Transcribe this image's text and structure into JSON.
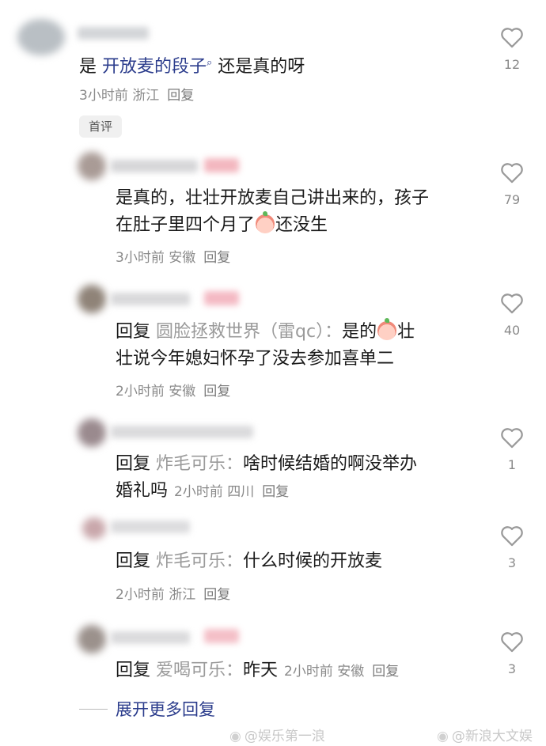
{
  "comment": {
    "prefix": "是 ",
    "link": "开放麦的段子",
    "suffix": " 还是真的呀",
    "meta": "3小时前 浙江",
    "reply_label": "回复",
    "likes": "12",
    "badge": "首评"
  },
  "replies": [
    {
      "line1": "是真的，壮壮开放麦自己讲出来的，孩子",
      "line2_a": "在肚子里四个月了",
      "line2_b": "还没生",
      "meta": "3小时前 安徽",
      "reply_label": "回复",
      "likes": "79"
    },
    {
      "reply_word": "回复",
      "target": "圆脸拯救世界（雷qc）：",
      "line1_rest": "是的",
      "line1_tail": "壮",
      "line2": "壮说今年媳妇怀孕了没去参加喜单二",
      "meta": "2小时前 安徽",
      "reply_label": "回复",
      "likes": "40"
    },
    {
      "reply_word": "回复",
      "target": "炸毛可乐：",
      "line1_rest": "啥时候结婚的啊没举办",
      "line2": "婚礼吗",
      "meta": "2小时前 四川",
      "reply_label": "回复",
      "likes": "1"
    },
    {
      "reply_word": "回复",
      "target": "炸毛可乐：",
      "line1_rest": "什么时候的开放麦",
      "meta": "2小时前 浙江",
      "reply_label": "回复",
      "likes": "3"
    },
    {
      "reply_word": "回复",
      "target": "爱喝可乐：",
      "line1_rest": "昨天",
      "meta": "2小时前 安徽",
      "reply_label": "回复",
      "likes": "3"
    }
  ],
  "expand_label": "展开更多回复",
  "watermarks": [
    "@娱乐第一浪",
    "@新浪大文娱"
  ],
  "colors": {
    "link": "#2b3c8c",
    "meta": "#8a8a8a",
    "heart": "#9a9a9a"
  },
  "icons": [
    "heart-outline-icon",
    "search-hint-icon",
    "weibo-logo-icon",
    "peach-emoji-icon"
  ]
}
